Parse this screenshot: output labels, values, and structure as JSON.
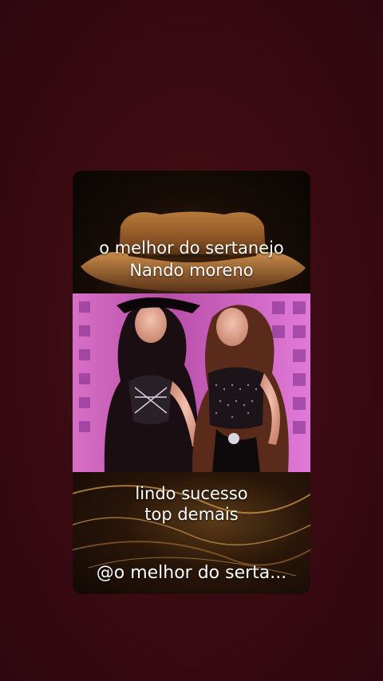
{
  "video": {
    "overlay_top": {
      "line1": "o melhor do sertanejo",
      "line2": "Nando moreno"
    },
    "overlay_bottom": {
      "line1": "lindo sucesso",
      "line2": "top demais"
    },
    "handle": "@o melhor do serta..."
  },
  "colors": {
    "background": "#3a0a12",
    "text": "#ffffff"
  }
}
